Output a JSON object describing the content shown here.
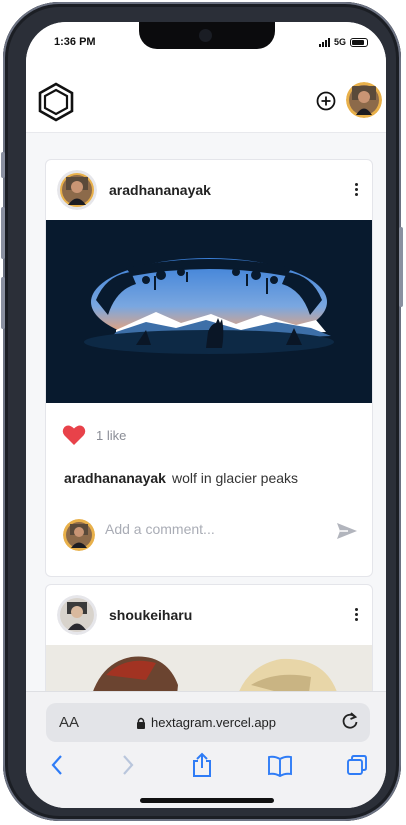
{
  "status_bar": {
    "time": "1:36 PM",
    "network": "5G"
  },
  "header": {
    "logo_icon": "hexagon-logo-icon",
    "new_post_icon": "plus-circle-icon"
  },
  "posts": [
    {
      "username": "aradhananayak",
      "image_desc": "wolf-silhouette-mountain-artwork",
      "likes": "1 like",
      "caption_user": "aradhananayak",
      "caption_text": "wolf in glacier peaks",
      "comment_placeholder": "Add a comment..."
    },
    {
      "username": "shoukeiharu"
    }
  ],
  "browser": {
    "text_size_label": "AA",
    "url": "hextagram.vercel.app"
  },
  "colors": {
    "heart": "#e8424a",
    "image_bg": "#081a2e"
  }
}
